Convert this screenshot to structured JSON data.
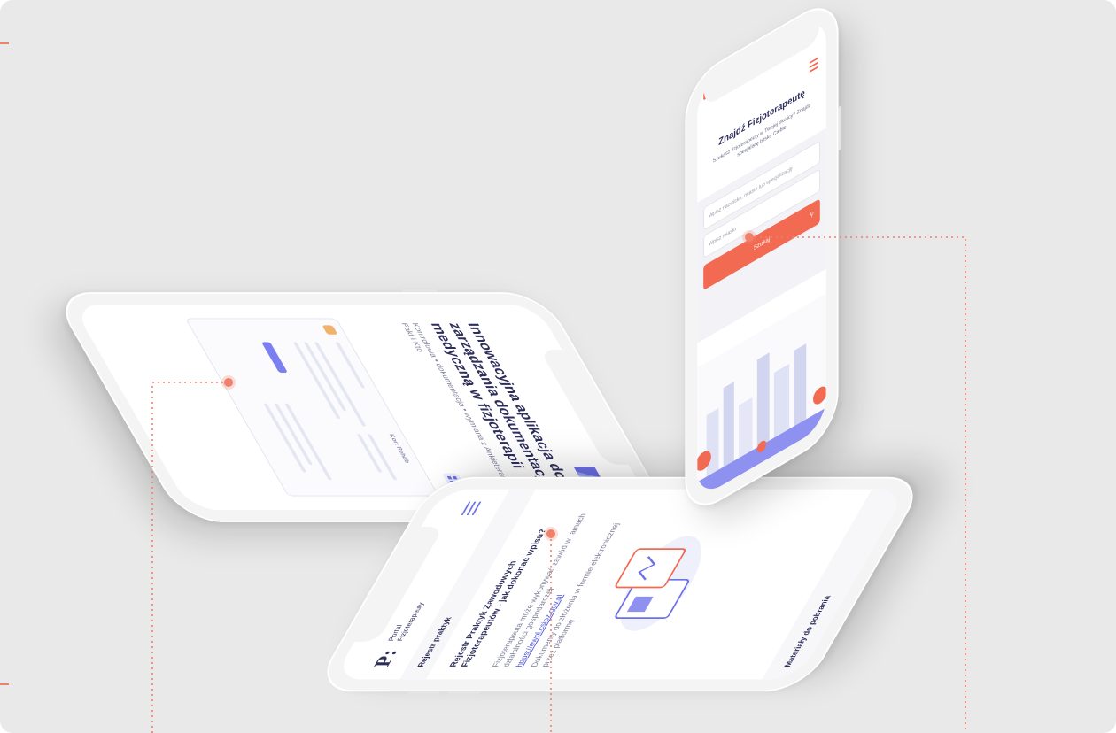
{
  "colors": {
    "background": "#e9e9e9",
    "accent": "#f26a52",
    "guide": "#f0806a",
    "brand_dark": "#2d2e5a",
    "brand_blue": "#6d70e8"
  },
  "phone_a": {
    "hero_title": "Innowacyjna aplikacja do zarządzania dokumentacją medyczną w fizjoterapii",
    "hero_subtitle": "Kontrolowa • dokumentacja • wymiana z Ankieterami • Fakt i Kto",
    "window_heading": "Kort Rehab"
  },
  "phone_b": {
    "logo_mark": "P:",
    "logo_text_1": "Portal",
    "logo_text_2": "Fizjoterapeuty",
    "menu_icon": "hamburger-icon",
    "section_label": "Rejestr praktyk",
    "article_title": "Rejestr Praktyk Zawodowych Fizjoterapeutów - jak dokonać wpisu?",
    "paragraph_1": "Fizjoterapeuta może wykonywać zawód w ramach działalności gospodarczej",
    "paragraph_2": "Dokumenty do złożenia w formie elektronicznej przez platformę",
    "link_text": "https://ewpl.csioz.gov.pl",
    "footer_heading": "Materiały do pobrania"
  },
  "phone_c": {
    "brand_name": "Znajdź Fizjoterapeutę",
    "page_title": "Znajdź Fizjoterapeutę",
    "intro_text": "Szukasz fizjoterapeuty w Twojej okolicy? Znajdź specjalistę blisko Ciebie",
    "field_1_placeholder": "Wpisz nazwisko, miasto lub specjalizację",
    "field_2_placeholder": "Wpisz miasto",
    "search_button": "Szukaj",
    "menu_icon": "hamburger-icon",
    "location_icon": "location-pin-icon"
  }
}
